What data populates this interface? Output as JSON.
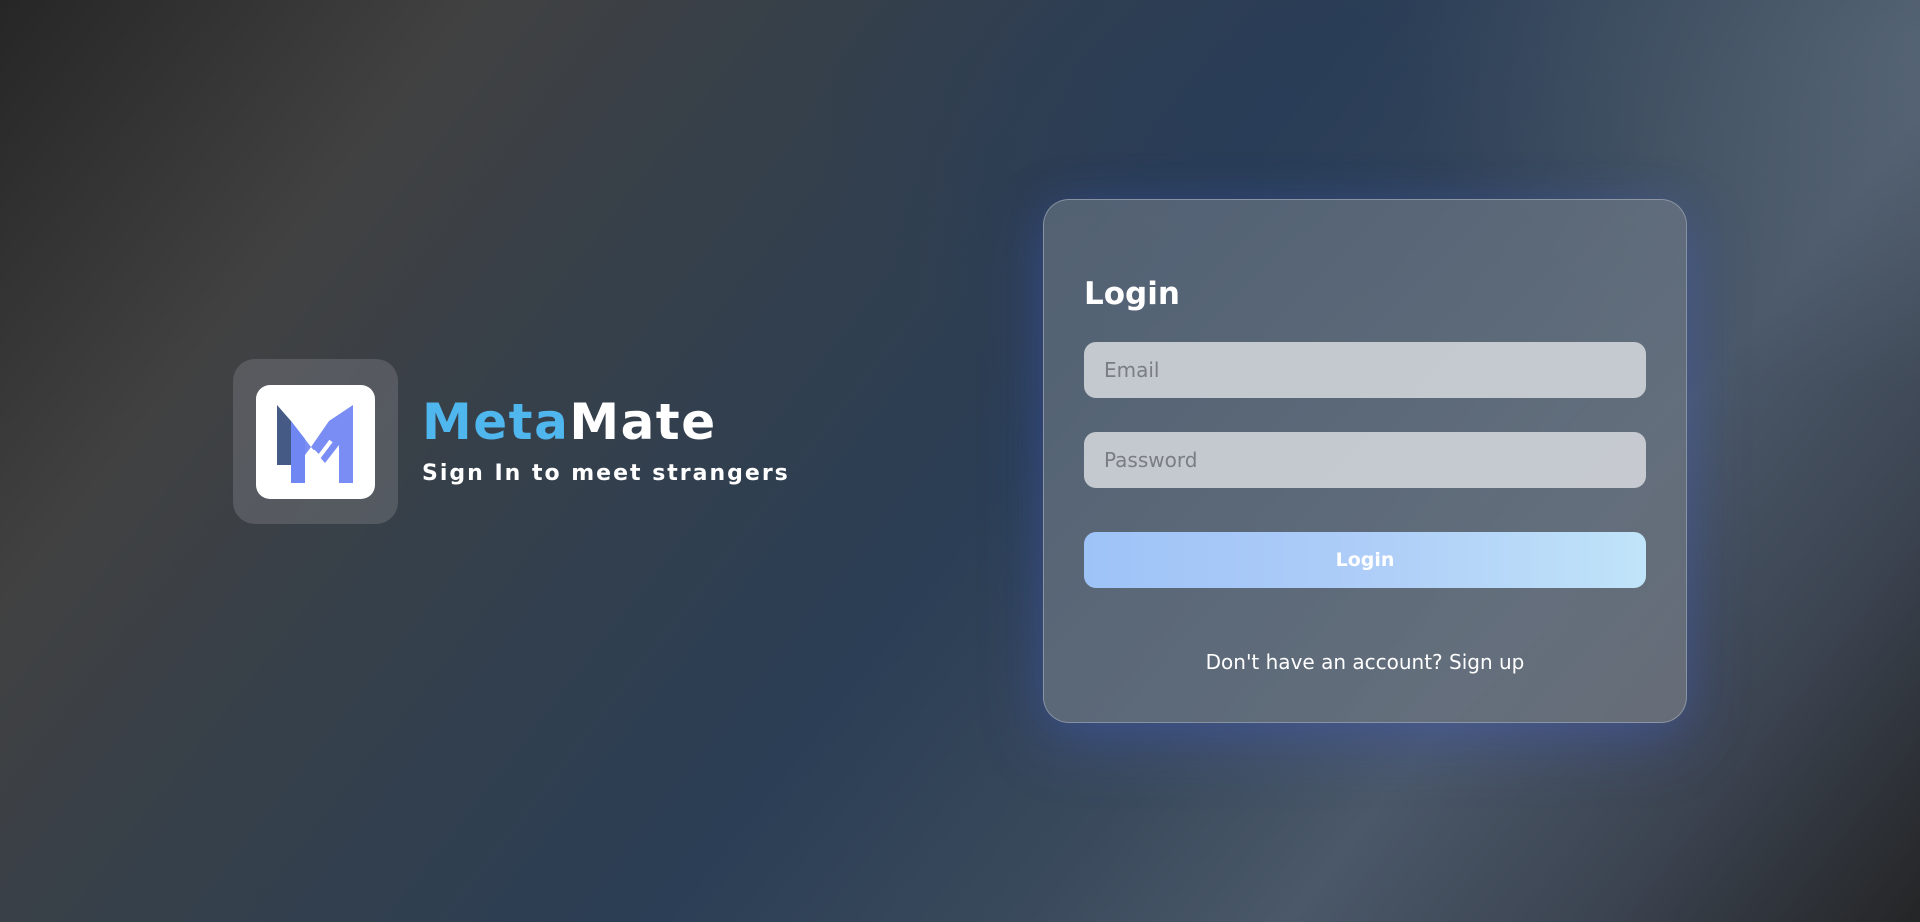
{
  "brand": {
    "name_part1": "Meta",
    "name_part2": "Mate",
    "tagline": "Sign In to meet strangers",
    "logo_icon": "metamate-m-logo",
    "accent_color": "#4fb6ee"
  },
  "login": {
    "title": "Login",
    "email_placeholder": "Email",
    "email_value": "",
    "password_placeholder": "Password",
    "password_value": "",
    "button_label": "Login",
    "signup_prompt": "Don't have an account?",
    "signup_link": "Sign up"
  }
}
